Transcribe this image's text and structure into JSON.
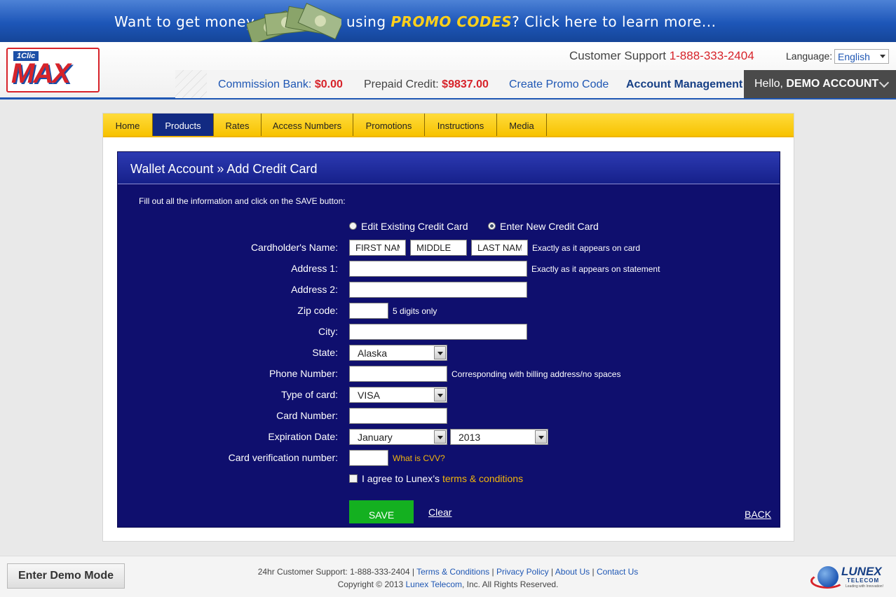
{
  "promo": {
    "text_before": "Want to get money",
    "text_mid": "using",
    "text_highlight": "PROMO CODES",
    "text_after": "? Click here to learn more..."
  },
  "logo": {
    "prefix": "1Clic",
    "name": "MAX"
  },
  "header": {
    "support_label": "Customer Support",
    "support_phone": "1-888-333-2404",
    "language_label": "Language:",
    "language_value": "English",
    "commission_label": "Commission Bank:",
    "commission_value": "$0.00",
    "prepaid_label": "Prepaid Credit:",
    "prepaid_value": "$9837.00",
    "create_promo": "Create Promo Code",
    "account_mgmt": "Account Management",
    "hello": "Hello,",
    "user_name": "DEMO ACCOUNT"
  },
  "menu": [
    {
      "label": "Home",
      "active": false
    },
    {
      "label": "Products",
      "active": true
    },
    {
      "label": "Rates",
      "active": false
    },
    {
      "label": "Access Numbers",
      "active": false
    },
    {
      "label": "Promotions",
      "active": false
    },
    {
      "label": "Instructions",
      "active": false
    },
    {
      "label": "Media",
      "active": false
    }
  ],
  "form": {
    "title": "Wallet Account » Add Credit Card",
    "instructions": "Fill out all the information and click on the SAVE button:",
    "radio_edit": "Edit Existing Credit Card",
    "radio_new": "Enter New Credit Card",
    "cardholder_label": "Cardholder's Name:",
    "first_name": "FIRST NAM",
    "middle_name": "MIDDLE",
    "last_name": "LAST NAMI",
    "cardholder_hint": "Exactly as it appears on card",
    "address1_label": "Address 1:",
    "address1_hint": "Exactly as it appears on statement",
    "address2_label": "Address 2:",
    "zip_label": "Zip code:",
    "zip_hint": "5 digits only",
    "city_label": "City:",
    "state_label": "State:",
    "state_value": "Alaska",
    "phone_label": "Phone Number:",
    "phone_hint": "Corresponding with billing address/no spaces",
    "card_type_label": "Type of card:",
    "card_type_value": "VISA",
    "card_number_label": "Card Number:",
    "expiration_label": "Expiration Date:",
    "exp_month": "January",
    "exp_year": "2013",
    "cvv_label": "Card verification number:",
    "cvv_hint": "What is CVV?",
    "agree_text": "I agree to Lunex’s",
    "terms_link": "terms & conditions",
    "save": "SAVE",
    "clear": "Clear",
    "back": "BACK"
  },
  "footer": {
    "demo_button": "Enter Demo Mode",
    "support": "24hr Customer Support: 1-888-333-2404 |",
    "terms": "Terms & Conditions",
    "privacy": "Privacy Policy",
    "about": "About Us",
    "contact": "Contact Us",
    "sep": "|",
    "copyright_pre": "Copyright © 2013",
    "company": "Lunex Telecom",
    "copyright_post": ", Inc. All Rights Reserved.",
    "brand": "LUNEX",
    "brand_sub": "TELECOM",
    "brand_tag": "Leading with Innovation!"
  },
  "colors": {
    "brand_blue": "#1f57b4",
    "brand_red": "#d7232a",
    "panel_navy": "#0f0f6e",
    "menu_gold": "#f7c200",
    "save_green": "#14b020"
  }
}
